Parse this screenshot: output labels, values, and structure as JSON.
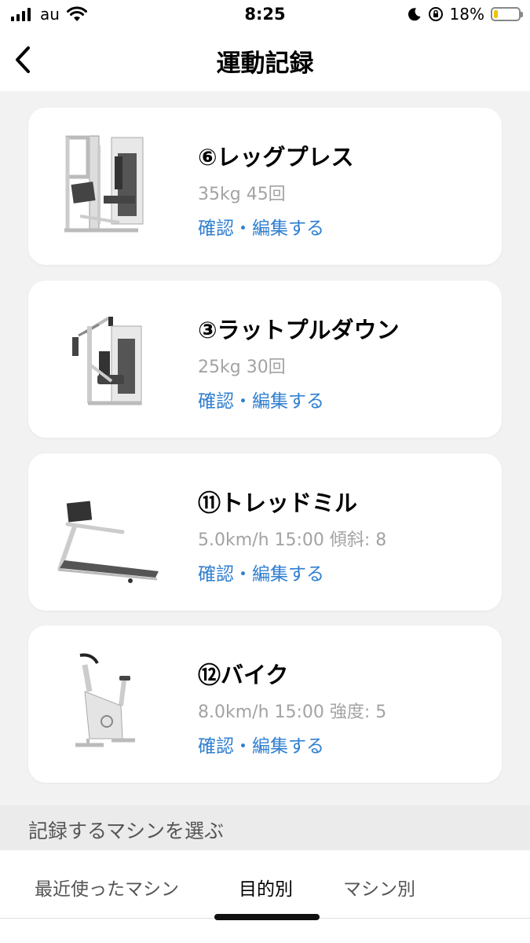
{
  "status_bar": {
    "carrier": "au",
    "time": "8:25",
    "battery_percent": "18%",
    "battery_level": 0.18,
    "icons": [
      "signal-icon",
      "wifi-icon",
      "moon-icon",
      "rotation-lock-icon",
      "battery-icon"
    ]
  },
  "header": {
    "title": "運動記録",
    "back_icon": "chevron-left-icon"
  },
  "records": [
    {
      "title": "⑥レッグプレス",
      "detail": "35kg 45回",
      "link": "確認・編集する",
      "icon": "leg-press-machine-image"
    },
    {
      "title": "③ラットプルダウン",
      "detail": "25kg 30回",
      "link": "確認・編集する",
      "icon": "lat-pulldown-machine-image"
    },
    {
      "title": "⑪トレッドミル",
      "detail": "5.0km/h 15:00 傾斜: 8",
      "link": "確認・編集する",
      "icon": "treadmill-image"
    },
    {
      "title": "⑫バイク",
      "detail": "8.0km/h 15:00 強度: 5",
      "link": "確認・編集する",
      "icon": "exercise-bike-image"
    }
  ],
  "machine_select": {
    "heading": "記録するマシンを選ぶ",
    "tabs": [
      {
        "label": "最近使ったマシン"
      },
      {
        "label": "目的別",
        "active": true
      },
      {
        "label": "マシン別"
      }
    ]
  },
  "colors": {
    "link": "#2f7fd0",
    "background": "#f2f2f2",
    "card": "#ffffff",
    "battery": "#f0c400"
  }
}
